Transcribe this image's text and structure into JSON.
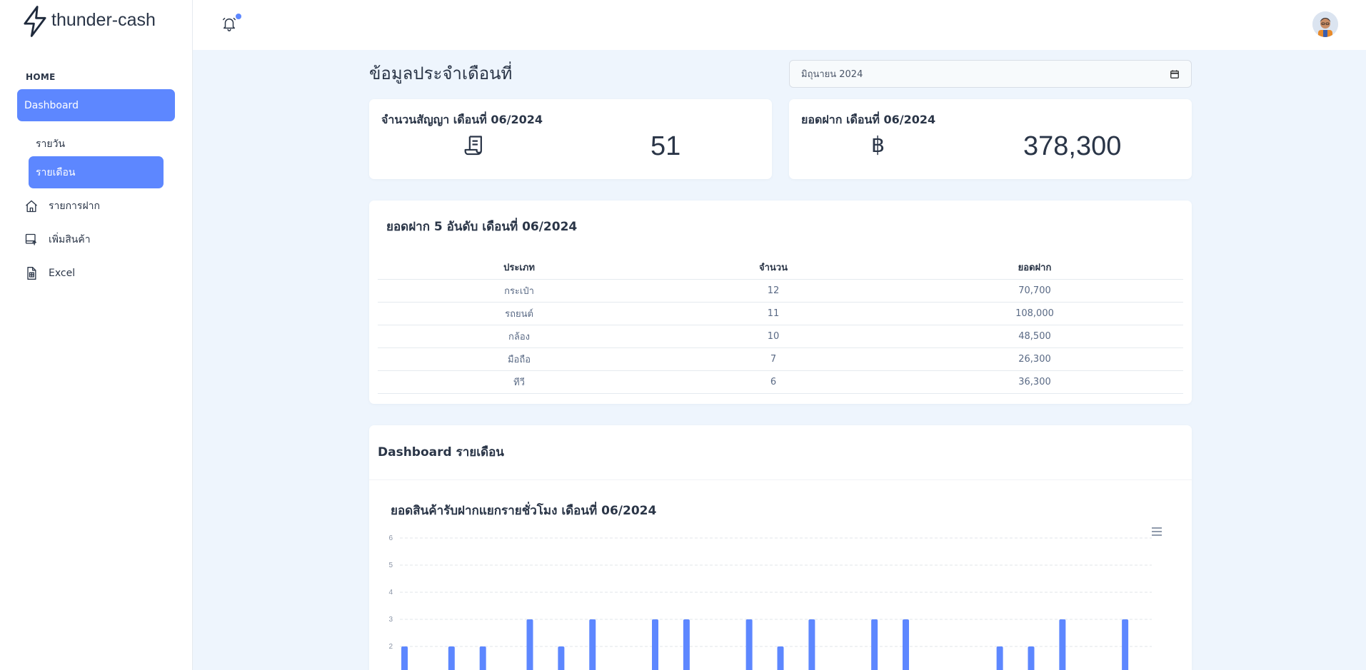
{
  "brand": {
    "name": "thunder-cash"
  },
  "sidebar": {
    "caption": "HOME",
    "items": [
      {
        "label": "Dashboard",
        "icon": "none",
        "active": true
      },
      {
        "label": "รายวัน",
        "icon": "none",
        "active": false
      },
      {
        "label": "รายเดือน",
        "icon": "none",
        "active": true
      },
      {
        "label": "รายการฝาก",
        "icon": "home-icon",
        "active": false
      },
      {
        "label": "เพิ่มสินค้า",
        "icon": "add-item-icon",
        "active": false
      },
      {
        "label": "Excel",
        "icon": "spreadsheet-file-icon",
        "active": false
      }
    ]
  },
  "header": {
    "notification_icon": "bell-icon",
    "avatar": "user-avatar"
  },
  "main": {
    "title": "ข้อมูลประจำเดือนที่",
    "month_value": "มิถุนายน 2024",
    "cards": [
      {
        "title": "จำนวนสัญญา เดือนที่ 06/2024",
        "icon": "receipt-icon",
        "value": "51"
      },
      {
        "title": "ยอดฝาก เดือนที่ 06/2024",
        "icon": "baht-icon",
        "value": "378,300"
      }
    ],
    "top5": {
      "title": "ยอดฝาก 5 อันดับ เดือนที่ 06/2024",
      "headers": [
        "ประเภท",
        "จำนวน",
        "ยอดฝาก"
      ],
      "rows": [
        [
          "กระเป๋า",
          "12",
          "70,700"
        ],
        [
          "รถยนต์",
          "11",
          "108,000"
        ],
        [
          "กล้อง",
          "10",
          "48,500"
        ],
        [
          "มือถือ",
          "7",
          "26,300"
        ],
        [
          "ทีวี",
          "6",
          "36,300"
        ]
      ]
    },
    "dashboard": {
      "title": "Dashboard รายเดือน"
    }
  },
  "chart_data": {
    "type": "bar",
    "title": "ยอดสินค้ารับฝากแยกรายชั่วโมง เดือนที่ 06/2024",
    "ylim": [
      0,
      6
    ],
    "y_ticks": [
      "2",
      "3",
      "4",
      "5",
      "6"
    ],
    "grid": true,
    "values": [
      2,
      0,
      0,
      2,
      0,
      2,
      0,
      0,
      3,
      0,
      2,
      0,
      3,
      0,
      0,
      0,
      3,
      0,
      3,
      0,
      0,
      0,
      3,
      0,
      2,
      0,
      3,
      0,
      0,
      0,
      3,
      0,
      3,
      0,
      0,
      0,
      0,
      0,
      2,
      0,
      2,
      0,
      3,
      0,
      0,
      0,
      3,
      0
    ],
    "data_labels_visible": [
      "3"
    ],
    "color": "#5d87ff"
  }
}
